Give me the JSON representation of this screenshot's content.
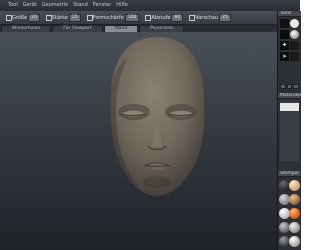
{
  "menubar": {
    "items": [
      "Tool",
      "Gerät",
      "Geometrie",
      "Stand",
      "Fenster",
      "Hilfe"
    ]
  },
  "toolbar": {
    "sliders": [
      {
        "label": "Größe",
        "value": "20"
      },
      {
        "label": "Stärke",
        "value": "25"
      },
      {
        "label": "Formschärfe",
        "value": "100"
      },
      {
        "label": "Abstufe",
        "value": "80"
      },
      {
        "label": "Vorschau",
        "value": "25"
      }
    ]
  },
  "tabs": {
    "items": [
      "Wiederholen",
      "Für Viewport",
      "Wand",
      "Panorama"
    ],
    "active_index": 2
  },
  "right_panel": {
    "tools_header": "Tools",
    "materials_header": "Materialien",
    "stamps_header": "Stempel"
  },
  "colors": {
    "accent": "#8a8e95",
    "face": "#7a7266",
    "material_orange": "#e0611e"
  }
}
